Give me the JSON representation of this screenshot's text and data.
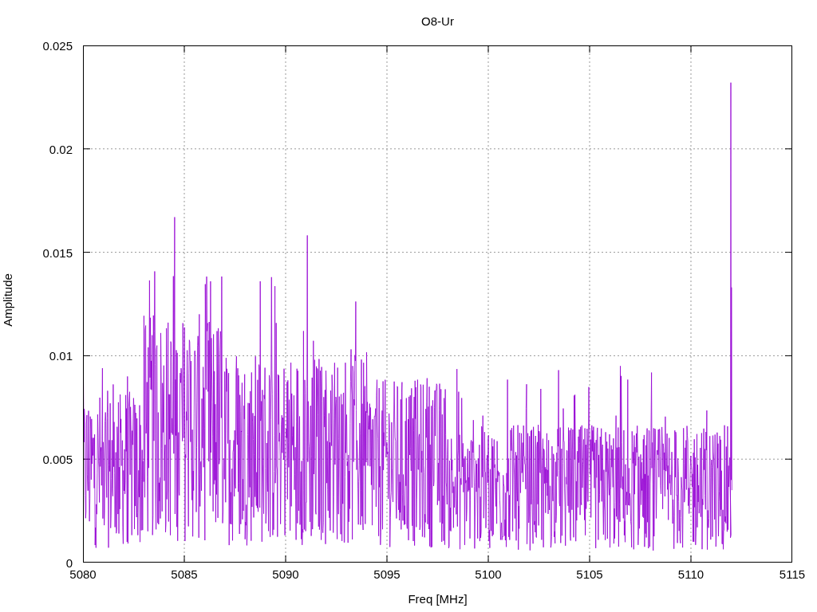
{
  "chart": {
    "title": "O8-Ur",
    "xlabel": "Freq [MHz]",
    "ylabel": "Amplitude",
    "xticks": [
      "5080",
      "5085",
      "5090",
      "5095",
      "5100",
      "5105",
      "5110",
      "5115"
    ],
    "yticks": [
      "0.025",
      "0.02",
      "0.015",
      "0.01",
      "0.005",
      "0"
    ]
  }
}
